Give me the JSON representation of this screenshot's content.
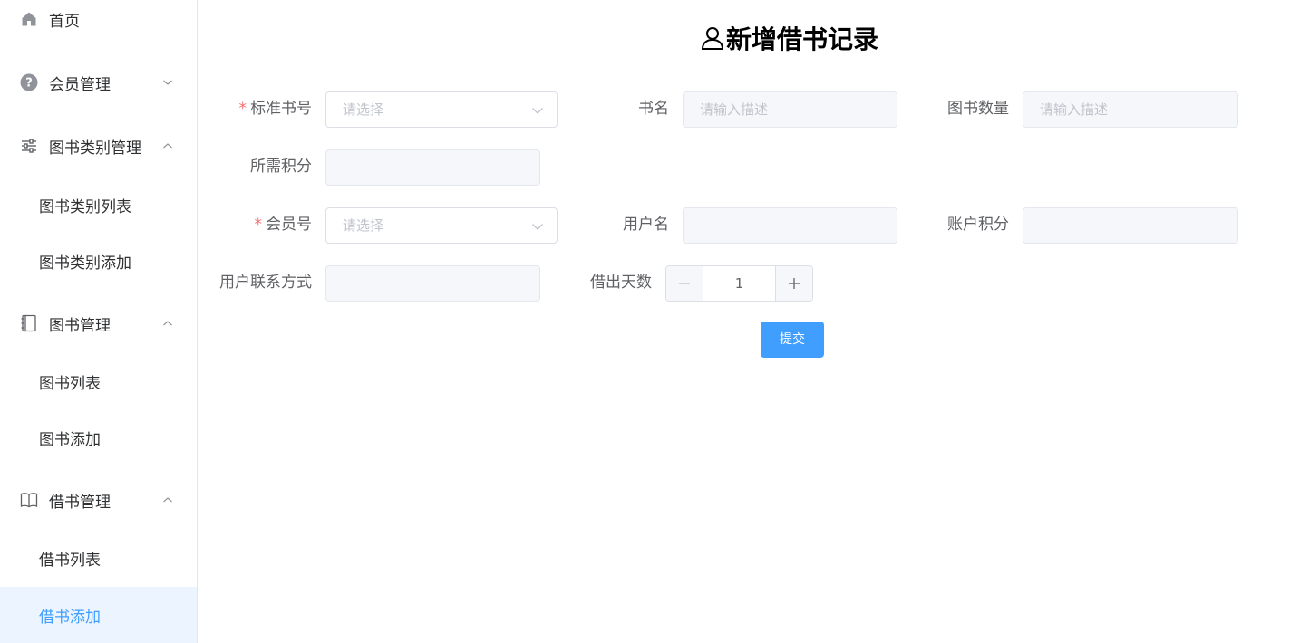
{
  "sidebar": {
    "items": [
      {
        "label": "首页",
        "icon": "home-icon"
      },
      {
        "label": "会员管理",
        "icon": "question-circle-icon"
      },
      {
        "label": "图书类别管理",
        "icon": "sliders-icon"
      },
      {
        "label": "图书类别列表"
      },
      {
        "label": "图书类别添加"
      },
      {
        "label": "图书管理",
        "icon": "notebook-icon"
      },
      {
        "label": "图书列表"
      },
      {
        "label": "图书添加"
      },
      {
        "label": "借书管理",
        "icon": "open-book-icon"
      },
      {
        "label": "借书列表"
      },
      {
        "label": "借书添加"
      }
    ]
  },
  "page": {
    "title": "新增借书记录",
    "title_icon": "user-icon"
  },
  "form": {
    "book_no_label": "标准书号",
    "book_no_placeholder": "请选择",
    "book_name_label": "书名",
    "book_name_placeholder": "请输入描述",
    "book_count_label": "图书数量",
    "book_count_placeholder": "请输入描述",
    "points_needed_label": "所需积分",
    "member_no_label": "会员号",
    "member_no_placeholder": "请选择",
    "username_label": "用户名",
    "account_points_label": "账户积分",
    "contact_label": "用户联系方式",
    "days_label": "借出天数",
    "days_value": "1",
    "required_mark": "*",
    "submit_label": "提交"
  },
  "colors": {
    "accent": "#409eff",
    "required": "#f56c6c",
    "active_bg": "#ecf5ff"
  }
}
